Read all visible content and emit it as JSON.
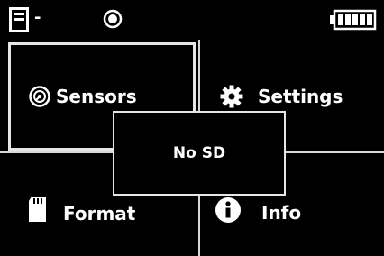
{
  "status": {
    "sd_indicator": "-",
    "icons": [
      "sd-card-icon",
      "record-icon",
      "battery-icon"
    ]
  },
  "menu": {
    "sensors": {
      "label": "Sensors",
      "icon": "sensor-dial-icon",
      "selected": true
    },
    "settings": {
      "label": "Settings",
      "icon": "gear-icon"
    },
    "format": {
      "label": "Format",
      "icon": "sd-card-icon"
    },
    "info": {
      "label": "Info",
      "icon": "info-icon"
    }
  },
  "popup": {
    "message": "No SD"
  },
  "colors": {
    "background": "#000000",
    "foreground": "#ffffff",
    "divider": "#d8d8d8"
  }
}
